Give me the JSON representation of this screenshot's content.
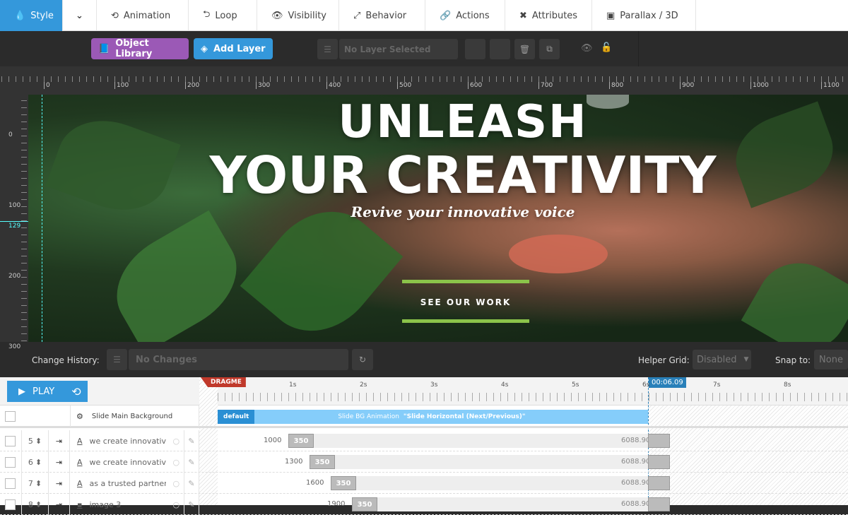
{
  "nav": {
    "tabs": [
      {
        "label": "Style",
        "icon": "drop-icon"
      },
      {
        "label": "",
        "icon": "chevron-down-icon"
      },
      {
        "label": "Animation",
        "icon": "history-icon"
      },
      {
        "label": "Loop",
        "icon": "loop-icon"
      },
      {
        "label": "Visibility",
        "icon": "eye-icon"
      },
      {
        "label": "Behavior",
        "icon": "expand-icon"
      },
      {
        "label": "Actions",
        "icon": "link-icon"
      },
      {
        "label": "Attributes",
        "icon": "tools-icon"
      },
      {
        "label": "Parallax / 3D",
        "icon": "image-icon"
      }
    ]
  },
  "toolbar": {
    "object_library": "Object Library",
    "add_layer": "Add Layer",
    "layer_select": "No Layer Selected"
  },
  "ruler": {
    "h": [
      "0",
      "100",
      "200",
      "300",
      "400",
      "500",
      "600",
      "700",
      "800",
      "900",
      "1000",
      "1100"
    ],
    "v": [
      "0",
      "100",
      "200",
      "300"
    ],
    "marker": "129"
  },
  "slide": {
    "title1": "UNLEASH",
    "title2": "YOUR CREATIVITY",
    "subtitle": "Revive your innovative voice",
    "cta": "SEE OUR WORK",
    "accent": "#8bc34a"
  },
  "history": {
    "label": "Change History:",
    "value": "No Changes",
    "grid_label": "Helper Grid:",
    "grid_value": "Disabled",
    "snap_label": "Snap to:",
    "snap_value": "None"
  },
  "timeline": {
    "play": "PLAY",
    "dragme": "DRAGME",
    "current_time": "00:06.09",
    "seconds": [
      "1s",
      "2s",
      "3s",
      "4s",
      "5s",
      "6s",
      "7s",
      "8s"
    ],
    "bg_row": {
      "label": "Slide Main Background",
      "badge": "default",
      "anim_label": "Slide BG Animation",
      "anim_value": "\"Slide Horizontal (Next/Previous)\""
    },
    "layers": [
      {
        "order": "5",
        "name": "we create innovativ",
        "type": "text",
        "start": "1000",
        "dur": "350",
        "end": "6088.90625"
      },
      {
        "order": "6",
        "name": "we create innovativ",
        "type": "text",
        "start": "1300",
        "dur": "350",
        "end": "6088.90625"
      },
      {
        "order": "7",
        "name": "as a trusted partner",
        "type": "text",
        "start": "1600",
        "dur": "350",
        "end": "6088.90625"
      },
      {
        "order": "8",
        "name": "image 3",
        "type": "image",
        "start": "1900",
        "dur": "350",
        "end": "6088.90625"
      }
    ]
  }
}
